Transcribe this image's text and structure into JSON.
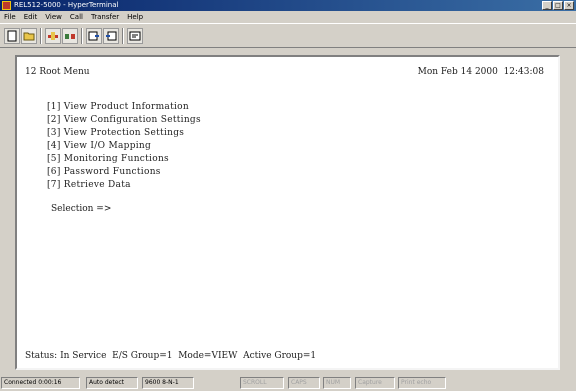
{
  "window": {
    "title": "REL512-5000 - HyperTerminal",
    "buttons": {
      "minimize": "_",
      "maximize": "□",
      "close": "×"
    }
  },
  "menubar": [
    "File",
    "Edit",
    "View",
    "Call",
    "Transfer",
    "Help"
  ],
  "toolbar": {
    "icons": [
      "new-connection-icon",
      "open-icon",
      "connect-icon",
      "disconnect-icon",
      "send-icon",
      "receive-icon",
      "properties-icon"
    ]
  },
  "terminal": {
    "header_left": "12 Root Menu",
    "header_right": "Mon Feb 14 2000  12:43:08",
    "menu_items": [
      "[1] View Product Information",
      "[2] View Configuration Settings",
      "[3] View Protection Settings",
      "[4] View I/O Mapping",
      "[5] Monitoring Functions",
      "[6] Password Functions",
      "[7] Retrieve Data"
    ],
    "prompt": "Selection =>",
    "status_line": "Status: In Service  E/S Group=1  Mode=VIEW  Active Group=1"
  },
  "statusbar": {
    "connected": "Connected 0:00:16",
    "detect": "Auto detect",
    "baud": "9600 8-N-1",
    "scroll": "SCROLL",
    "caps": "CAPS",
    "num": "NUM",
    "capture": "Capture",
    "print_echo": "Print echo"
  }
}
